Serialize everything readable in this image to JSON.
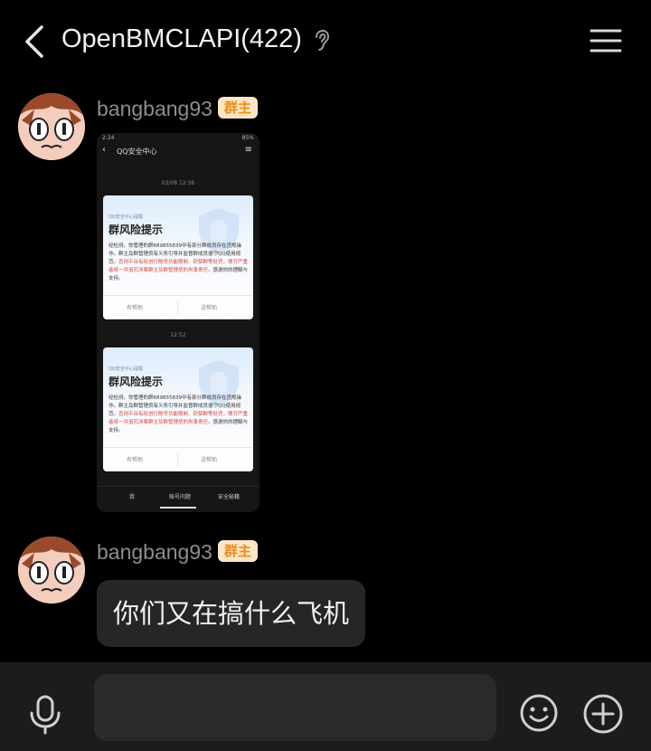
{
  "header": {
    "title": "OpenBMCLAPI(422)",
    "back_icon": "chevron-left-icon",
    "ear_icon": "ear-icon",
    "menu_icon": "hamburger-menu-icon"
  },
  "messages": [
    {
      "sender": "bangbang93",
      "role_badge": "群主",
      "type": "image",
      "image": {
        "status_left": "2:24",
        "status_right": "85%",
        "nav_title": "QQ安全中心",
        "time_1": "03/08 12:36",
        "time_2": "12:52",
        "card_label": "QQ安全中心提醒",
        "card_title": "群风险提示",
        "card_body_1": "经检测，你管理的群689855839中有部分群成员存在违规操作。群主及群管理员有义务引导并监督群成员遵守QQ使用规范。",
        "card_body_red": "否则平台有权进行账号功能限制、封禁群等处罚，情节严重者将一并追究涉案群主及群管理员的刑事责任。",
        "card_body_2": "感谢你的理解与支持。",
        "btn_helpful": "有帮助",
        "btn_unhelpful": "没帮助",
        "tab_1": "我",
        "tab_2": "账号问题",
        "tab_3": "安全秘籍"
      }
    },
    {
      "sender": "bangbang93",
      "role_badge": "群主",
      "type": "text",
      "text": "你们又在搞什么飞机"
    }
  ],
  "input_bar": {
    "placeholder": "",
    "mic_icon": "microphone-icon",
    "emoji_icon": "smiley-icon",
    "plus_icon": "plus-circle-icon"
  },
  "colors": {
    "background": "#000000",
    "bubble": "#262626",
    "badge_bg": "#fbe6c7",
    "badge_text": "#f08c16",
    "bottom_bar": "#1c1c1c"
  }
}
